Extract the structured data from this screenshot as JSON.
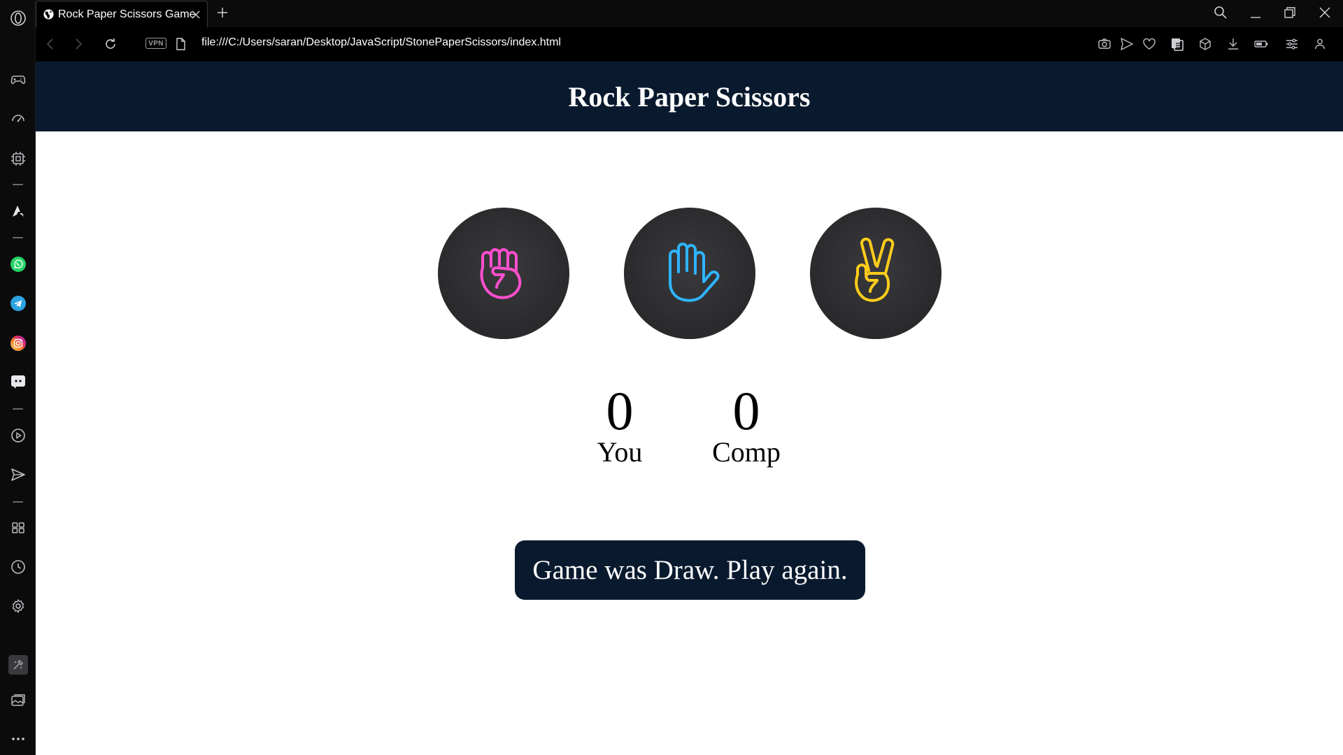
{
  "browser": {
    "tab": {
      "title": "Rock Paper Scissors Game"
    },
    "address": {
      "vpn_label": "VPN",
      "url": "file:///C:/Users/saran/Desktop/JavaScript/StonePaperScissors/index.html"
    },
    "sidebar_icons": [
      "opera-logo-icon",
      "gamepad-icon",
      "speed-dial-icon",
      "cpu-icon",
      "aria-icon",
      "whatsapp-icon",
      "telegram-icon",
      "instagram-icon",
      "discord-icon",
      "player-icon",
      "send-icon",
      "workspaces-icon",
      "history-icon",
      "settings-icon",
      "extensions-icon",
      "gallery-icon",
      "more-icon"
    ],
    "colors": {
      "whatsapp": "#25d366",
      "telegram": "#2aa3e0",
      "instagram": "#e1306c"
    }
  },
  "game": {
    "title": "Rock Paper Scissors",
    "choices": [
      {
        "id": "rock",
        "icon": "rock-fist-icon",
        "color": "#ff4fcf"
      },
      {
        "id": "paper",
        "icon": "paper-hand-icon",
        "color": "#2fb4ff"
      },
      {
        "id": "scissors",
        "icon": "scissors-hand-icon",
        "color": "#ffcc1a"
      }
    ],
    "scores": {
      "user": {
        "value": "0",
        "label": "You"
      },
      "comp": {
        "value": "0",
        "label": "Comp"
      }
    },
    "message": "Game was Draw. Play again.",
    "colors": {
      "header_bg": "#0a1a2e",
      "message_bg": "#0a1a2e",
      "choice_bg": "#2c2c2e"
    }
  }
}
